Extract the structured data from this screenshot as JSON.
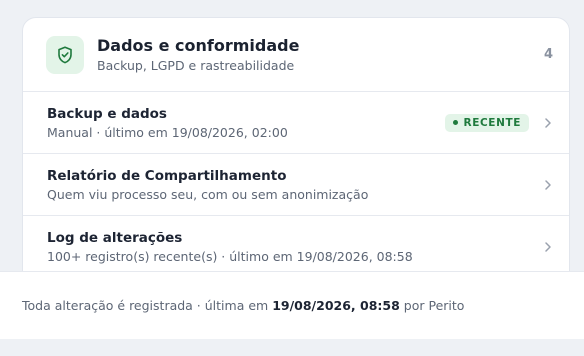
{
  "section": {
    "title": "Dados e conformidade",
    "subtitle": "Backup, LGPD e rastreabilidade",
    "count": "4",
    "icon": "shield-check-icon"
  },
  "items": [
    {
      "title": "Backup e dados",
      "subtitle": "Manual · último em 19/08/2026, 02:00",
      "badge": "RECENTE"
    },
    {
      "title": "Relatório de Compartilhamento",
      "subtitle": "Quem viu processo seu, com ou sem anonimização"
    },
    {
      "title": "Log de alterações",
      "subtitle": "100+ registro(s) recente(s) · último em 19/08/2026, 08:58"
    }
  ],
  "footer": {
    "prefix": "Toda alteração é registrada · última em",
    "timestamp": "19/08/2026, 08:58",
    "suffix": "por Perito"
  },
  "colors": {
    "accent_green": "#1f7a3d",
    "badge_bg": "#e3f4e8",
    "background": "#eef1f5"
  }
}
